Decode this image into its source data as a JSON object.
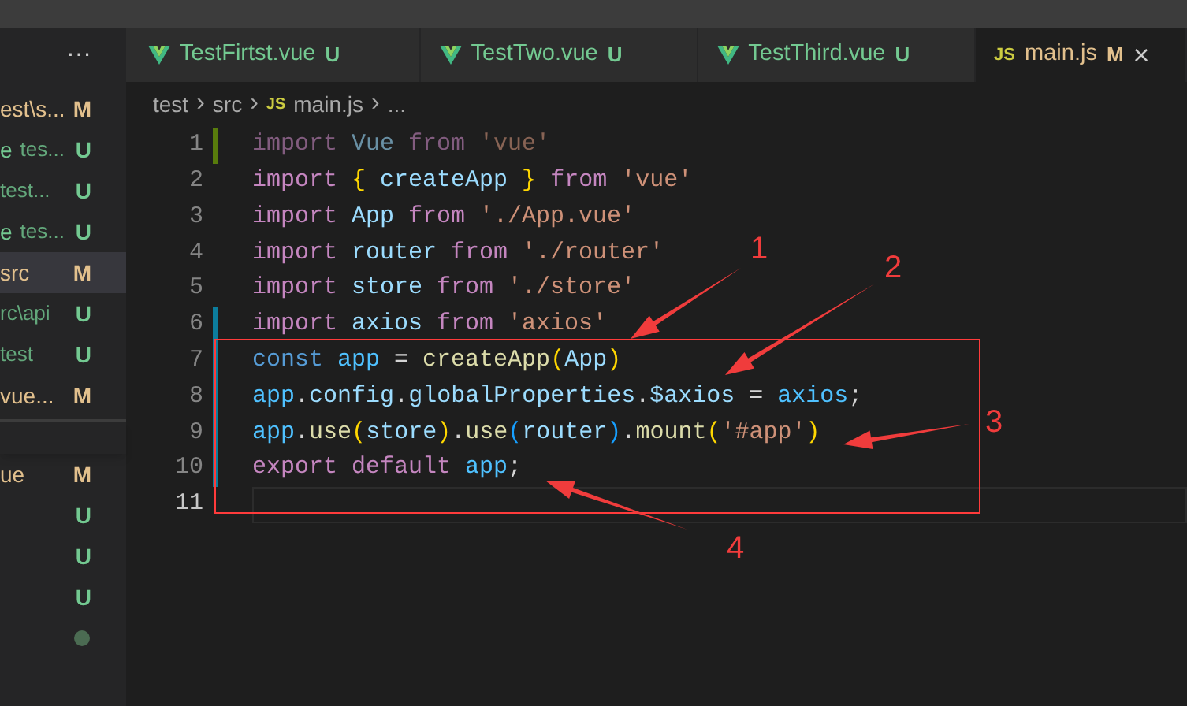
{
  "sidebar": {
    "more": "···",
    "items": [
      {
        "label": "est\\s...",
        "status": "M",
        "selected": false
      },
      {
        "label": "e",
        "detail": "tes...",
        "status": "U",
        "selected": false
      },
      {
        "detail": "test...",
        "status": "U",
        "selected": false
      },
      {
        "label": "e",
        "detail": "tes...",
        "status": "U",
        "selected": false
      },
      {
        "label": "src",
        "status": "M",
        "selected": true
      },
      {
        "detail": "rc\\api",
        "status": "U",
        "selected": false
      },
      {
        "detail": "test",
        "status": "U",
        "selected": false
      },
      {
        "label": "vue...",
        "status": "M",
        "selected": false
      }
    ],
    "files": [
      {
        "kind": "status",
        "label": "ue",
        "status": "M"
      },
      {
        "kind": "status",
        "status": "U"
      },
      {
        "kind": "status",
        "status": "U"
      },
      {
        "kind": "status",
        "status": "U"
      },
      {
        "kind": "dot"
      }
    ]
  },
  "tabs": [
    {
      "kind": "vue",
      "label": "TestFirtst.vue",
      "status": "U",
      "selected": false
    },
    {
      "kind": "vue",
      "label": "TestTwo.vue",
      "status": "U",
      "selected": false
    },
    {
      "kind": "vue",
      "label": "TestThird.vue",
      "status": "U",
      "selected": false
    },
    {
      "kind": "js",
      "icon": "JS",
      "label": "main.js",
      "status": "M",
      "selected": true,
      "close": "×"
    }
  ],
  "breadcrumb": [
    {
      "kind": "item",
      "text": "test"
    },
    {
      "kind": "separator",
      "text": "›"
    },
    {
      "kind": "item",
      "text": "src"
    },
    {
      "kind": "separator",
      "text": "›"
    },
    {
      "kind": "icon",
      "text": "JS"
    },
    {
      "kind": "item",
      "text": "main.js"
    },
    {
      "kind": "separator",
      "text": "›"
    },
    {
      "kind": "item",
      "text": "..."
    }
  ],
  "code": {
    "lines": [
      {
        "number": "1",
        "added": true,
        "modified": false,
        "current": false,
        "faded": true,
        "tokens": [
          {
            "kind": "keyword",
            "text": "import "
          },
          {
            "kind": "variable",
            "text": "Vue "
          },
          {
            "kind": "keyword",
            "text": "from "
          },
          {
            "kind": "string",
            "text": "'vue'"
          }
        ]
      },
      {
        "number": "2",
        "added": false,
        "modified": false,
        "current": false,
        "faded": false,
        "tokens": [
          {
            "kind": "keyword",
            "text": "import "
          },
          {
            "kind": "brace",
            "text": "{ "
          },
          {
            "kind": "variable",
            "text": "createApp "
          },
          {
            "kind": "brace",
            "text": "} "
          },
          {
            "kind": "keyword",
            "text": "from "
          },
          {
            "kind": "string",
            "text": "'vue'"
          }
        ]
      },
      {
        "number": "3",
        "added": false,
        "modified": false,
        "current": false,
        "faded": false,
        "tokens": [
          {
            "kind": "keyword",
            "text": "import "
          },
          {
            "kind": "variable",
            "text": "App "
          },
          {
            "kind": "keyword",
            "text": "from "
          },
          {
            "kind": "string",
            "text": "'./App.vue'"
          }
        ]
      },
      {
        "number": "4",
        "added": false,
        "modified": false,
        "current": false,
        "faded": false,
        "tokens": [
          {
            "kind": "keyword",
            "text": "import "
          },
          {
            "kind": "variable",
            "text": "router "
          },
          {
            "kind": "keyword",
            "text": "from "
          },
          {
            "kind": "string",
            "text": "'./router'"
          }
        ]
      },
      {
        "number": "5",
        "added": false,
        "modified": false,
        "current": false,
        "faded": false,
        "tokens": [
          {
            "kind": "keyword",
            "text": "import "
          },
          {
            "kind": "variable",
            "text": "store "
          },
          {
            "kind": "keyword",
            "text": "from "
          },
          {
            "kind": "string",
            "text": "'./store'"
          }
        ]
      },
      {
        "number": "6",
        "added": false,
        "modified": true,
        "current": false,
        "faded": false,
        "tokens": [
          {
            "kind": "keyword",
            "text": "import "
          },
          {
            "kind": "variable",
            "text": "axios "
          },
          {
            "kind": "keyword",
            "text": "from "
          },
          {
            "kind": "string",
            "text": "'axios'"
          }
        ]
      },
      {
        "number": "7",
        "added": false,
        "modified": true,
        "current": false,
        "faded": false,
        "tokens": [
          {
            "kind": "storage",
            "text": "const "
          },
          {
            "kind": "constant",
            "text": "app "
          },
          {
            "kind": "plain",
            "text": "= "
          },
          {
            "kind": "function",
            "text": "createApp"
          },
          {
            "kind": "brace",
            "text": "("
          },
          {
            "kind": "variable",
            "text": "App"
          },
          {
            "kind": "brace",
            "text": ")"
          }
        ]
      },
      {
        "number": "8",
        "added": false,
        "modified": true,
        "current": false,
        "faded": false,
        "tokens": [
          {
            "kind": "constant",
            "text": "app"
          },
          {
            "kind": "plain",
            "text": "."
          },
          {
            "kind": "variable",
            "text": "config"
          },
          {
            "kind": "plain",
            "text": "."
          },
          {
            "kind": "variable",
            "text": "globalProperties"
          },
          {
            "kind": "plain",
            "text": "."
          },
          {
            "kind": "variable",
            "text": "$axios "
          },
          {
            "kind": "plain",
            "text": "= "
          },
          {
            "kind": "constant",
            "text": "axios"
          },
          {
            "kind": "plain",
            "text": ";"
          }
        ]
      },
      {
        "number": "9",
        "added": false,
        "modified": true,
        "current": false,
        "faded": false,
        "tokens": [
          {
            "kind": "constant",
            "text": "app"
          },
          {
            "kind": "plain",
            "text": "."
          },
          {
            "kind": "function",
            "text": "use"
          },
          {
            "kind": "brace",
            "text": "("
          },
          {
            "kind": "variable",
            "text": "store"
          },
          {
            "kind": "brace",
            "text": ")"
          },
          {
            "kind": "plain",
            "text": "."
          },
          {
            "kind": "function",
            "text": "use"
          },
          {
            "kind": "paren2",
            "text": "("
          },
          {
            "kind": "variable",
            "text": "router"
          },
          {
            "kind": "paren2",
            "text": ")"
          },
          {
            "kind": "plain",
            "text": "."
          },
          {
            "kind": "function",
            "text": "mount"
          },
          {
            "kind": "brace",
            "text": "("
          },
          {
            "kind": "string",
            "text": "'#app'"
          },
          {
            "kind": "brace",
            "text": ")"
          }
        ]
      },
      {
        "number": "10",
        "added": false,
        "modified": true,
        "current": false,
        "faded": false,
        "tokens": [
          {
            "kind": "keyword",
            "text": "export "
          },
          {
            "kind": "keyword",
            "text": "default "
          },
          {
            "kind": "constant",
            "text": "app"
          },
          {
            "kind": "plain",
            "text": ";"
          }
        ]
      },
      {
        "number": "11",
        "added": false,
        "modified": false,
        "current": true
      }
    ]
  },
  "annotations": [
    {
      "label": "1"
    },
    {
      "label": "2"
    },
    {
      "label": "3"
    },
    {
      "label": "4"
    }
  ]
}
